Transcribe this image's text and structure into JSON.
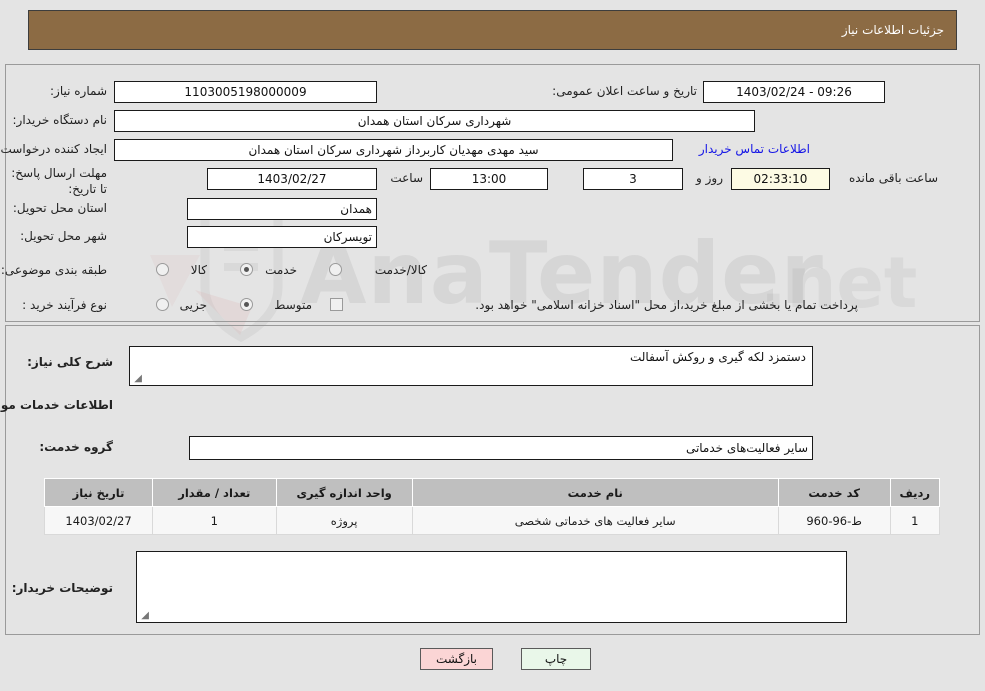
{
  "header": {
    "title": "جزئیات اطلاعات نیاز"
  },
  "fields": {
    "need_number_label": "شماره نیاز:",
    "need_number_value": "1103005198000009",
    "announce_label": "تاریخ و ساعت اعلان عمومی:",
    "announce_value": "09:26 - 1403/02/24",
    "buyer_org_label": "نام دستگاه خریدار:",
    "buyer_org_value": "شهرداری سرکان استان همدان",
    "creator_label": "ایجاد کننده درخواست:",
    "creator_value": "سید مهدی مهدیان کاربرداز شهرداری سرکان استان همدان",
    "contact_link": "اطلاعات تماس خریدار",
    "deadline_label": "مهلت ارسال پاسخ: تا تاریخ:",
    "deadline_date": "1403/02/27",
    "hour_label": "ساعت",
    "hour_value": "13:00",
    "days_value": "3",
    "days_word": "روز و",
    "countdown_value": "02:33:10",
    "remaining_text": "ساعت باقی مانده",
    "province_label": "استان محل تحویل:",
    "province_value": "همدان",
    "city_label": "شهر محل تحویل:",
    "city_value": "تویسرکان",
    "category_label": "طبقه بندی موضوعی:",
    "process_label": "نوع فرآیند خرید :"
  },
  "category_options": [
    {
      "label": "کالا",
      "selected": false
    },
    {
      "label": "خدمت",
      "selected": true
    },
    {
      "label": "کالا/خدمت",
      "selected": false
    }
  ],
  "process_options": [
    {
      "label": "جزیی",
      "selected": false
    },
    {
      "label": "متوسط",
      "selected": true
    }
  ],
  "treasury": {
    "checked": false,
    "text": "پرداخت تمام یا بخشی از مبلغ خرید،از محل \"اسناد خزانه اسلامی\" خواهد بود."
  },
  "description": {
    "label": "شرح کلی نیاز:",
    "value": "دستمزد لکه گیری و روکش آسفالت"
  },
  "services_section": {
    "heading": "اطلاعات خدمات مورد نیاز",
    "group_label": "گروه خدمت:",
    "group_value": "سایر فعالیت‌های خدماتی"
  },
  "table": {
    "columns": [
      "ردیف",
      "کد خدمت",
      "نام خدمت",
      "واحد اندازه گیری",
      "تعداد / مقدار",
      "تاریخ نیاز"
    ],
    "rows": [
      {
        "row": "1",
        "code": "ط-96-960",
        "name": "سایر فعالیت های خدماتی شخصی",
        "unit": "پروژه",
        "qty": "1",
        "date": "1403/02/27"
      }
    ]
  },
  "buyer_notes": {
    "label": "توضیحات خریدار:",
    "value": ""
  },
  "buttons": {
    "print": "چاپ",
    "back": "بازگشت"
  },
  "watermark": {
    "text": "AnaTender.net"
  },
  "colors": {
    "header_bg": "#8c6b44",
    "page_bg": "#e4e4e4",
    "link": "#1414e6",
    "print_btn": "#e9f7e9",
    "back_btn": "#fbd5d5"
  }
}
